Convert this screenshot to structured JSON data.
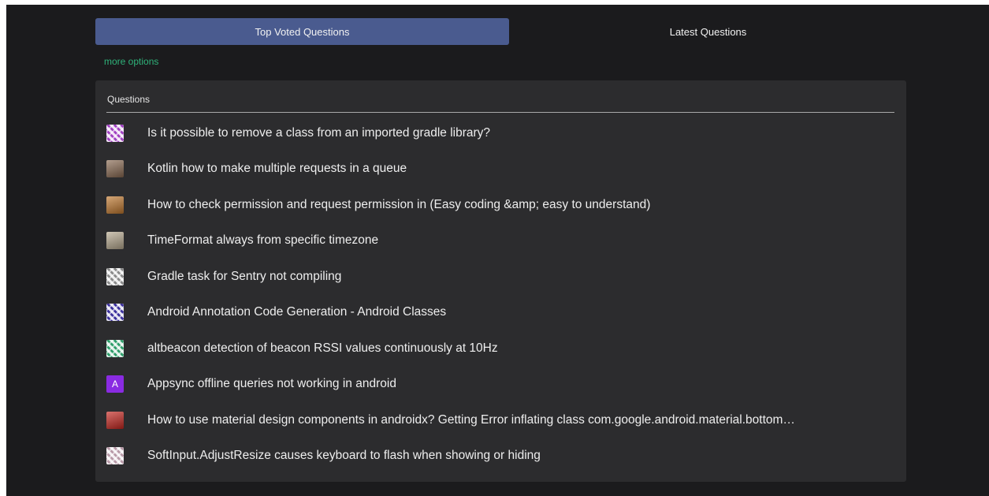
{
  "tabs": {
    "top_voted": "Top Voted Questions",
    "latest": "Latest Questions"
  },
  "more_options": "more options",
  "panel": {
    "title": "Questions"
  },
  "questions": [
    {
      "title": "Is it possible to remove a class from an imported gradle library?",
      "avatar_icon": "identicon-purple",
      "avatar_letter": "",
      "avatar_color": "#a03fc1"
    },
    {
      "title": "Kotlin how to make multiple requests in a queue",
      "avatar_icon": "photo-avatar",
      "avatar_letter": "",
      "avatar_color": "#8a6a52"
    },
    {
      "title": "How to check permission and request permission in (Easy coding &amp; easy to understand)",
      "avatar_icon": "photo-avatar",
      "avatar_letter": "",
      "avatar_color": "#c0782e"
    },
    {
      "title": "TimeFormat always from specific timezone",
      "avatar_icon": "photo-avatar",
      "avatar_letter": "",
      "avatar_color": "#b7a98f"
    },
    {
      "title": "Gradle task for Sentry not compiling",
      "avatar_icon": "identicon-gray",
      "avatar_letter": "",
      "avatar_color": "#8a8a8a"
    },
    {
      "title": "Android Annotation Code Generation - Android Classes",
      "avatar_icon": "identicon-indigo",
      "avatar_letter": "",
      "avatar_color": "#3a2f9c"
    },
    {
      "title": "altbeacon detection of beacon RSSI values continuously at 10Hz",
      "avatar_icon": "identicon-green",
      "avatar_letter": "",
      "avatar_color": "#2e9e6a"
    },
    {
      "title": "Appsync offline queries not working in android",
      "avatar_icon": "letter-avatar",
      "avatar_letter": "A",
      "avatar_color": "#8a2be2"
    },
    {
      "title": "How to use material design components in androidx? Getting Error inflating class com.google.android.material.bottom…",
      "avatar_icon": "photo-avatar",
      "avatar_letter": "",
      "avatar_color": "#c6261f"
    },
    {
      "title": "SoftInput.AdjustResize causes keyboard to flash when showing or hiding",
      "avatar_icon": "identicon-pink",
      "avatar_letter": "",
      "avatar_color": "#b89aa8"
    }
  ]
}
